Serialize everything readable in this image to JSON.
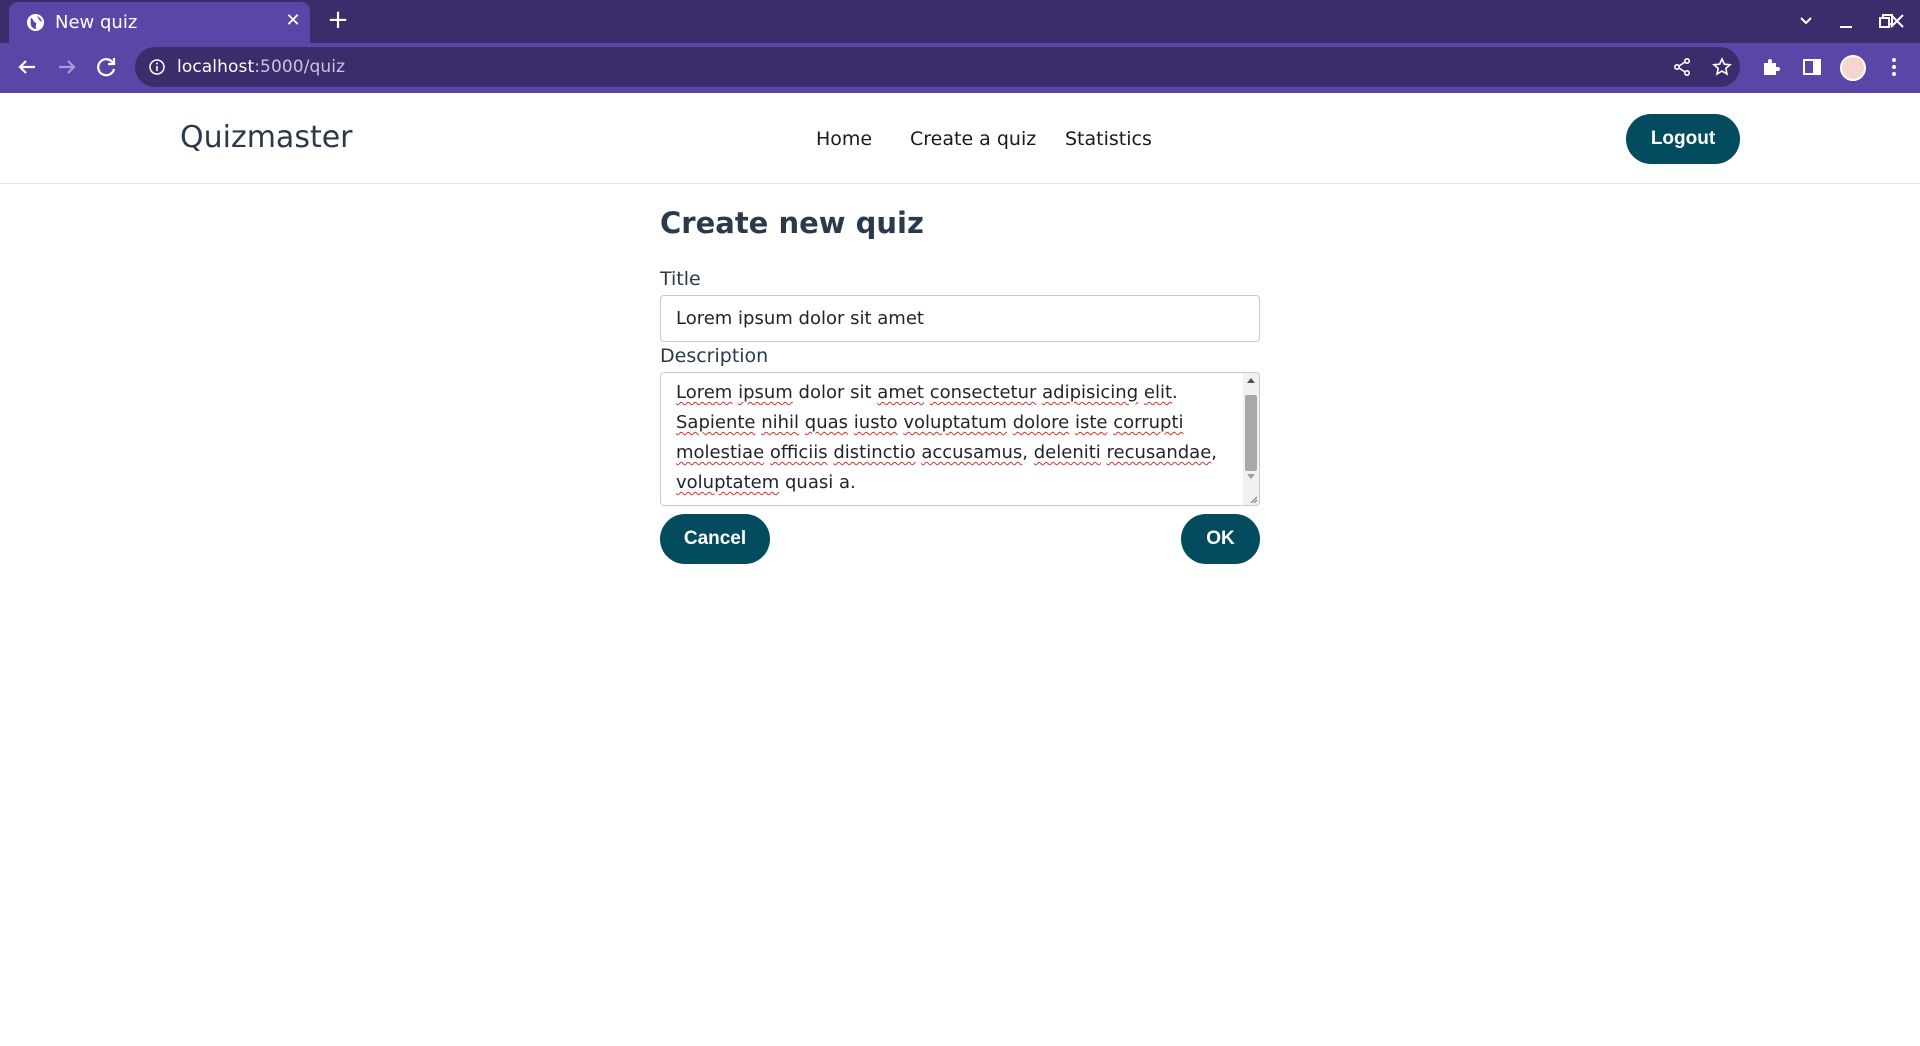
{
  "browser": {
    "tab_title": "New quiz",
    "url_host": "localhost",
    "url_path": ":5000/quiz",
    "colors": {
      "tabbar": "#3b2d6b",
      "toolbar": "#5b46a8"
    }
  },
  "header": {
    "brand": "Quizmaster",
    "nav": [
      "Home",
      "Create a quiz",
      "Statistics"
    ],
    "logout_label": "Logout"
  },
  "form": {
    "heading": "Create new quiz",
    "title_label": "Title",
    "title_value": "Lorem ipsum dolor sit amet",
    "description_label": "Description",
    "description_value": "Lorem ipsum dolor sit amet consectetur adipisicing elit. Sapiente nihil quas iusto voluptatum dolore iste corrupti molestiae officiis distinctio accusamus, deleniti recusandae, voluptatem quasi a.",
    "cancel_label": "Cancel",
    "ok_label": "OK"
  },
  "theme": {
    "primary": "#034b5e",
    "text": "#2b3a4a"
  }
}
